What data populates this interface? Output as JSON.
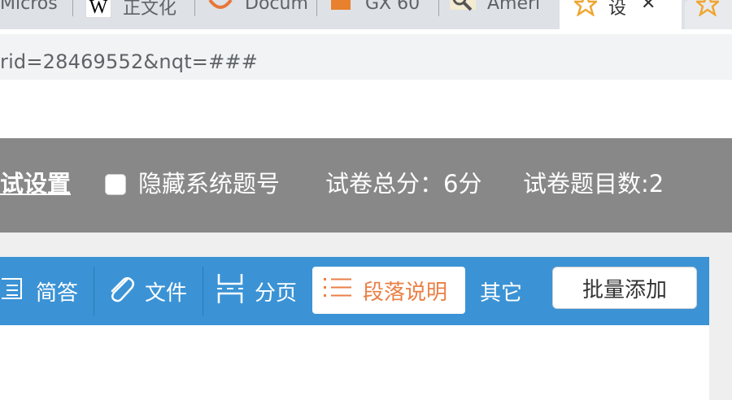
{
  "browser": {
    "tabs": [
      {
        "label": "Micros",
        "icon": "microsoft-icon"
      },
      {
        "label": "正文化",
        "icon": "wikipedia-icon"
      },
      {
        "label": "Docum",
        "icon": "orange-arc-icon"
      },
      {
        "label": "GX 60",
        "icon": "book-icon"
      },
      {
        "label": "Ameri",
        "icon": "magnifier-icon"
      },
      {
        "label": "设",
        "icon": "star-icon",
        "active": true
      },
      {
        "label": "",
        "icon": "star-icon"
      }
    ],
    "close_glyph": "✕",
    "url": "rid=28469552&nqt=###"
  },
  "settings": {
    "exam_settings_link": "试设置",
    "hide_numbers_label": "隐藏系统题号",
    "total_score": "试卷总分：6分",
    "question_count": "试卷题目数:2"
  },
  "toolbar": {
    "items": [
      {
        "label": "简答",
        "icon": "short-answer-icon"
      },
      {
        "label": "文件",
        "icon": "paperclip-icon"
      },
      {
        "label": "分页",
        "icon": "page-break-icon"
      },
      {
        "label": "段落说明",
        "icon": "list-icon",
        "active": true
      },
      {
        "label": "其它",
        "icon": ""
      }
    ],
    "batch_add_label": "批量添加"
  },
  "colors": {
    "toolbar_bg": "#3b93d5",
    "active_text": "#ea7f45",
    "settings_bg": "#888888",
    "tab_active_icon": "#f0a632"
  }
}
